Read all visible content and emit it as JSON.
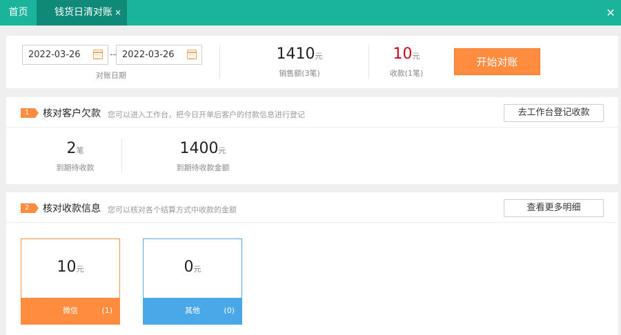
{
  "tabs": {
    "home": "首页",
    "active": "钱货日清对账",
    "close_glyph": "×",
    "window_close_glyph": "✕"
  },
  "summary": {
    "date_start": "2022-03-26",
    "date_sep": "--",
    "date_end": "2022-03-26",
    "date_caption": "对账日期",
    "sales_amount": "1410",
    "sales_unit": "元",
    "sales_caption": "销售额(3笔)",
    "receipts_amount": "10",
    "receipts_unit": "元",
    "receipts_caption": "收款(1笔)",
    "start_button": "开始对账",
    "icons": [
      "calendar-icon"
    ],
    "accent_color": "#ff8c3f"
  },
  "section1": {
    "badge": "1",
    "title": "核对客户欠款",
    "desc": "您可以进入工作台，把今日开单后客户的付款信息进行登记",
    "button": "去工作台登记收款",
    "due_count": "2",
    "due_count_unit": "笔",
    "due_count_caption": "到期待收款",
    "due_amount": "1400",
    "due_amount_unit": "元",
    "due_amount_caption": "到期待收款金额"
  },
  "section2": {
    "badge": "2",
    "title": "核对收款信息",
    "desc": "您可以核对各个结算方式中收款的金额",
    "button": "查看更多明细",
    "cards": [
      {
        "amount": "10",
        "unit": "元",
        "name": "微信",
        "count": "(1)",
        "color": "#ff8c3f"
      },
      {
        "amount": "0",
        "unit": "元",
        "name": "其他",
        "count": "(0)",
        "color": "#4aa8e8"
      }
    ]
  },
  "colors": {
    "topbar": "#1ab39b",
    "active_tab": "#108a78",
    "receipts_red": "#d0021b"
  }
}
